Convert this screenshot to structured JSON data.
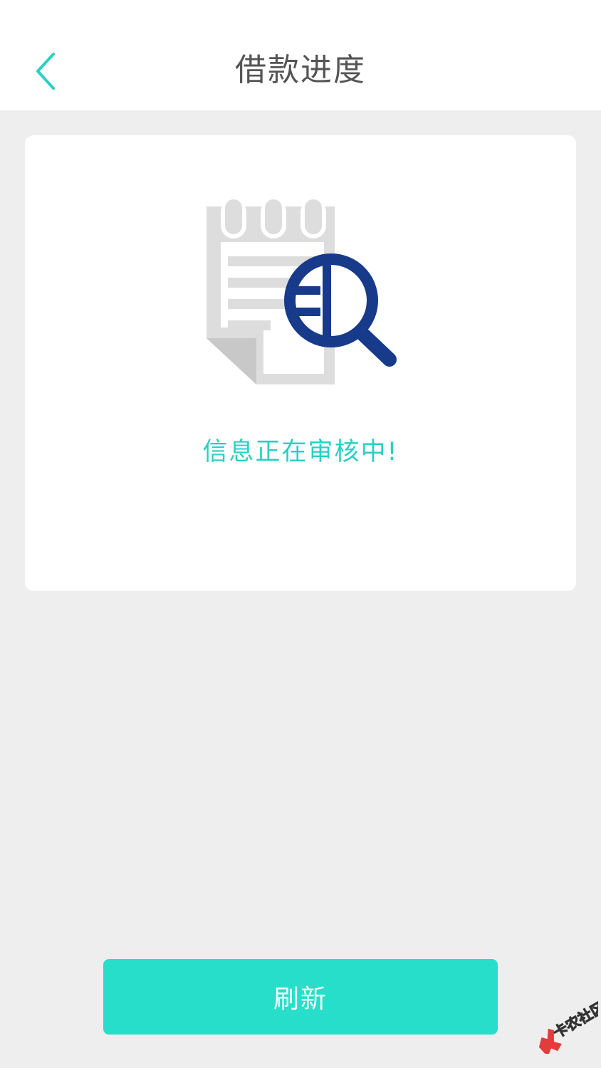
{
  "header": {
    "title": "借款进度"
  },
  "card": {
    "status_text": "信息正在审核中!"
  },
  "actions": {
    "refresh_label": "刷新"
  },
  "watermark": {
    "text": "卡农社区"
  },
  "colors": {
    "accent": "#26dec9",
    "status_text": "#2ad0c3",
    "back_icon": "#2ad0c3",
    "magnifier": "#173a8a",
    "document": "#dddddd",
    "page_background": "#eeeeee"
  },
  "icons": {
    "back": "chevron-left-icon",
    "illustration": "document-search-icon"
  }
}
